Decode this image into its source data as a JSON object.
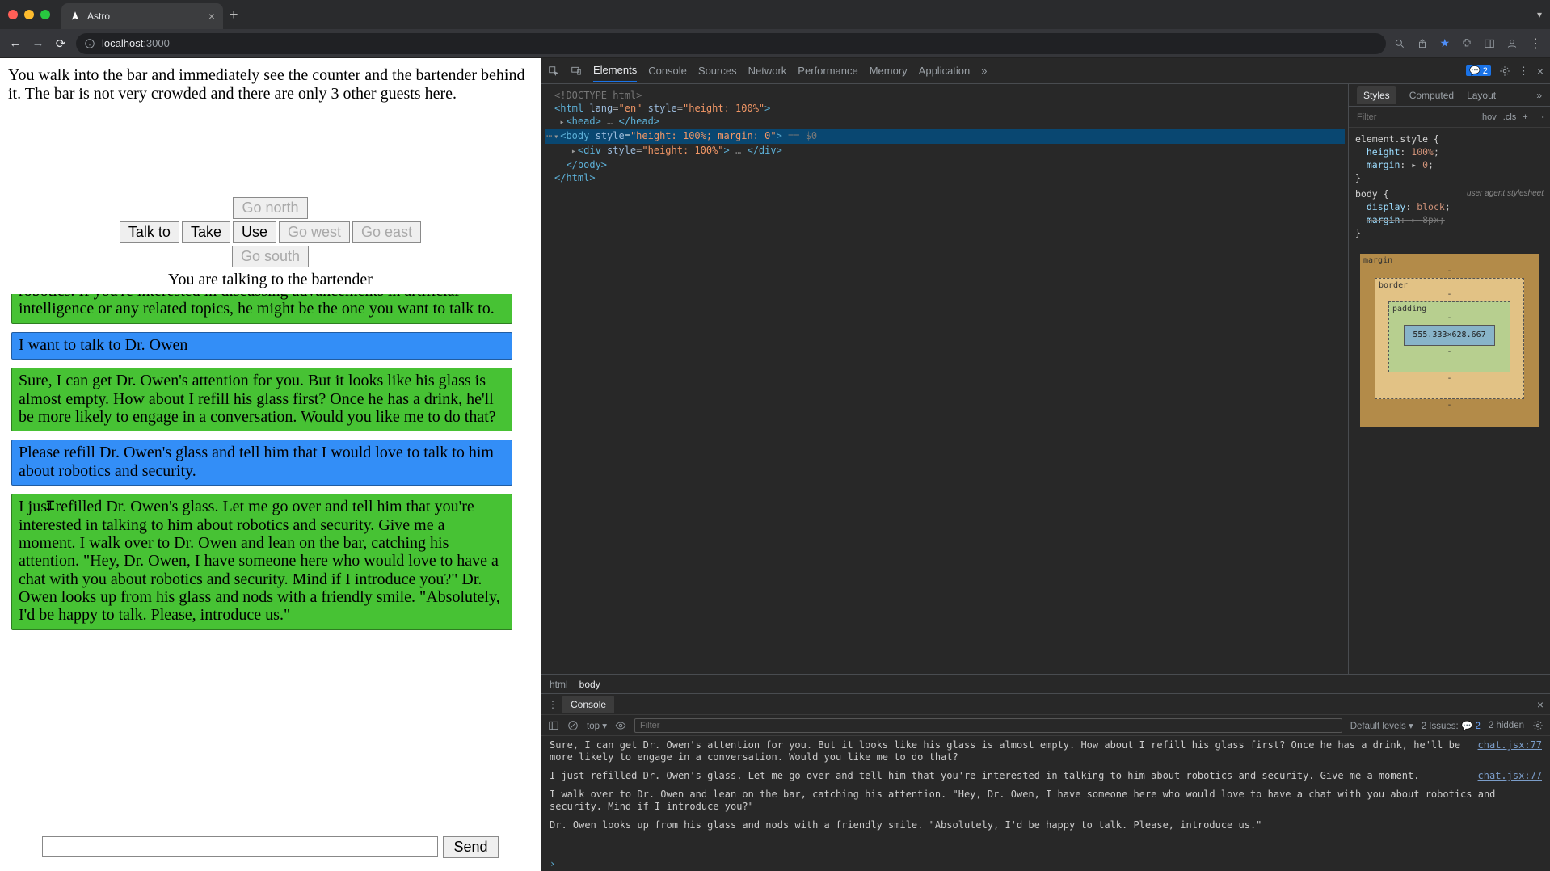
{
  "browser": {
    "tab_title": "Astro",
    "url_host": "localhost",
    "url_port": ":3000"
  },
  "game": {
    "narrative": "You walk into the bar and immediately see the counter and the bartender behind it. The bar is not very crowded and there are only 3 other guests here.",
    "buttons": {
      "talk": "Talk to",
      "take": "Take",
      "use": "Use",
      "north": "Go north",
      "west": "Go west",
      "east": "Go east",
      "south": "Go south"
    },
    "status": "You are talking to the bartender",
    "messages": [
      {
        "who": "npc",
        "text": "robotics. If you're interested in discussing advancements in artificial intelligence or any related topics, he might be the one you want to talk to.",
        "partial_top": true
      },
      {
        "who": "user",
        "text": "I want to talk to Dr. Owen"
      },
      {
        "who": "npc",
        "text": "Sure, I can get Dr. Owen's attention for you. But it looks like his glass is almost empty. How about I refill his glass first? Once he has a drink, he'll be more likely to engage in a conversation. Would you like me to do that?"
      },
      {
        "who": "user",
        "text": "Please refill Dr. Owen's glass and tell him that I would love to talk to him about robotics and security."
      },
      {
        "who": "npc",
        "text": "I just refilled Dr. Owen's glass. Let me go over and tell him that you're interested in talking to him about robotics and security. Give me a moment. I walk over to Dr. Owen and lean on the bar, catching his attention. \"Hey, Dr. Owen, I have someone here who would love to have a chat with you about robotics and security. Mind if I introduce you?\" Dr. Owen looks up from his glass and nods with a friendly smile. \"Absolutely, I'd be happy to talk. Please, introduce us.\""
      }
    ],
    "send_label": "Send",
    "input_value": ""
  },
  "devtools": {
    "tabs": [
      "Elements",
      "Console",
      "Sources",
      "Network",
      "Performance",
      "Memory",
      "Application"
    ],
    "active_tab": "Elements",
    "issues_count": "2",
    "styles_tabs": [
      "Styles",
      "Computed",
      "Layout"
    ],
    "filter_placeholder": "Filter",
    "hov": ":hov",
    "cls": ".cls",
    "dom": {
      "l0": "<!DOCTYPE html>",
      "l1a": "<html ",
      "l1_attr": "lang",
      "l1_val": "\"en\"",
      "l1_attr2": "style",
      "l1_val2": "\"height: 100%\"",
      "l1z": ">",
      "l2": "<head>",
      "l2z": "</head>",
      "l3a": "<body ",
      "l3_attr": "style",
      "l3_val": "\"height: 100%; margin: 0\"",
      "l3z": "> == $0",
      "l4a": "<div ",
      "l4_attr": "style",
      "l4_val": "\"height: 100%\"",
      "l4z": "> … </div>",
      "l5": "</body>",
      "l6": "</html>"
    },
    "styles": {
      "sel1": "element.style {",
      "p1": "height",
      "v1": "100%",
      "p2": "margin",
      "v2": "0",
      "close1": "}",
      "sel2": "body {",
      "ua": "user agent stylesheet",
      "p3": "display",
      "v3": "block",
      "p4": "margin",
      "v4": "8px",
      "close2": "}"
    },
    "boxmodel": {
      "margin": "margin",
      "border": "border",
      "padding": "padding",
      "content": "555.333×628.667",
      "dash": "-"
    },
    "breadcrumb": [
      "html",
      "body"
    ],
    "console": {
      "title": "Console",
      "context": "top",
      "filter_placeholder": "Filter",
      "levels": "Default levels",
      "issues_label": "2 Issues:",
      "issues_count": "2",
      "hidden": "2 hidden",
      "src": "chat.jsx:77",
      "logs": [
        "Sure, I can get Dr. Owen's attention for you. But it looks like his glass is almost empty. How about I refill his glass first? Once he has a drink, he'll be more likely to engage in a conversation. Would you like me to do that?",
        "I just refilled Dr. Owen's glass. Let me go over and tell him that you're interested in talking to him about robotics and security. Give me a moment.",
        "I walk over to Dr. Owen and lean on the bar, catching his attention. \"Hey, Dr. Owen, I have someone here who would love to have a chat with you about robotics and security. Mind if I introduce you?\"",
        "Dr. Owen looks up from his glass and nods with a friendly smile. \"Absolutely, I'd be happy to talk. Please, introduce us.\""
      ]
    }
  }
}
